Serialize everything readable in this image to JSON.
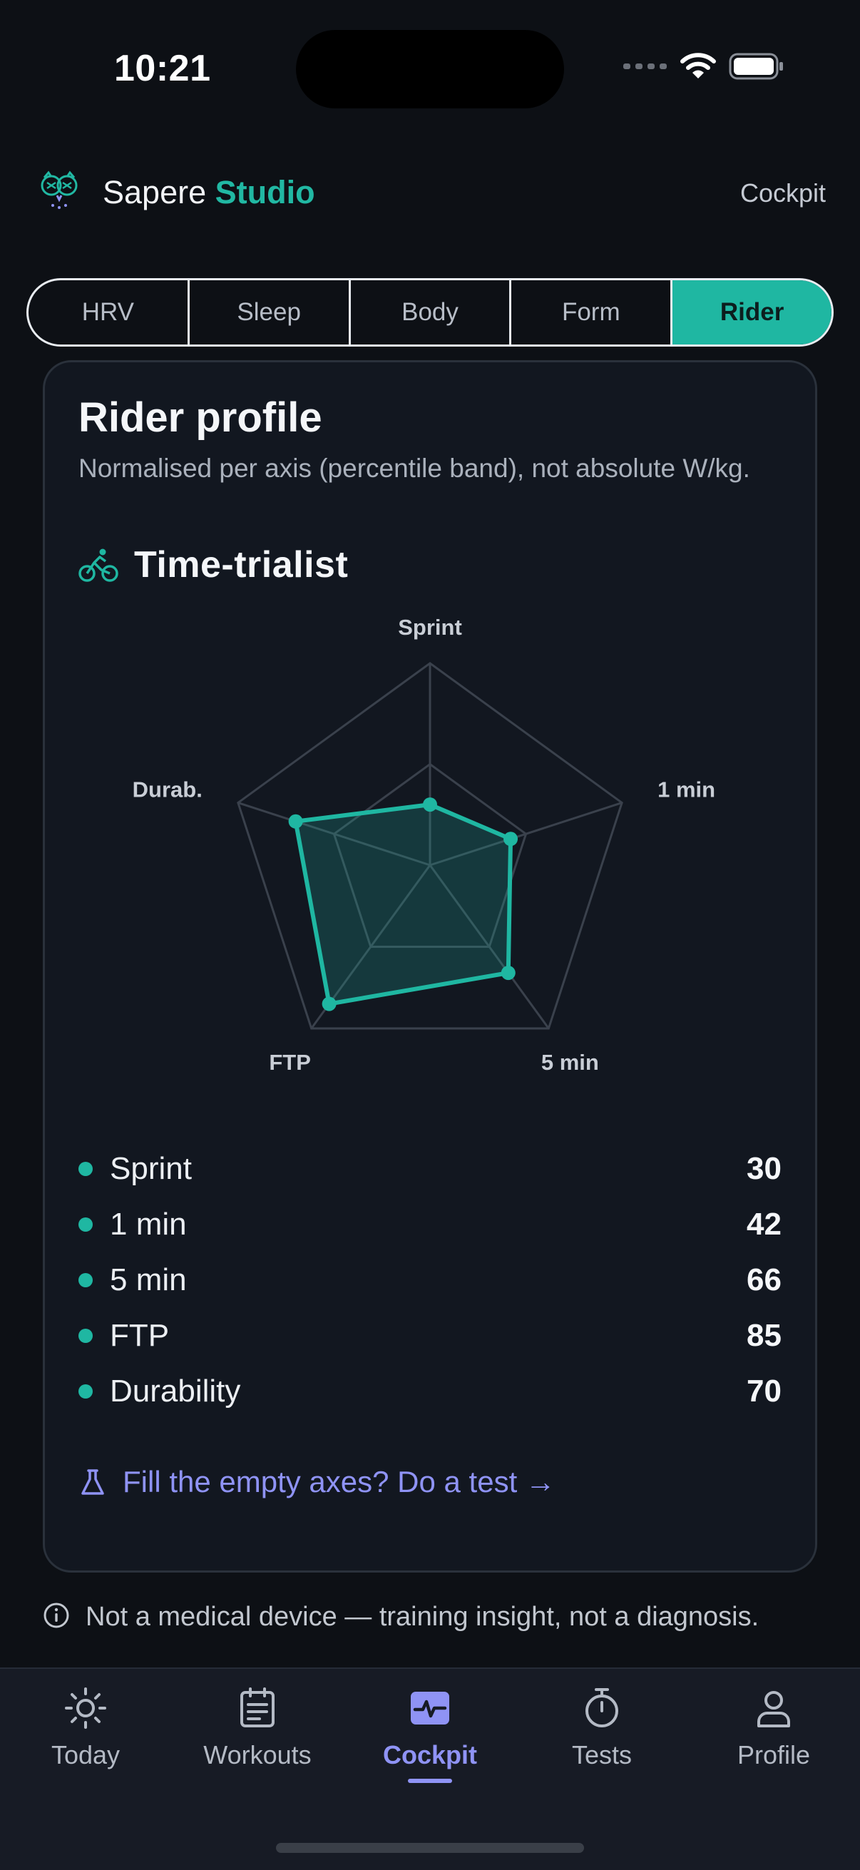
{
  "status": {
    "time": "10:21"
  },
  "header": {
    "brand_main": "Sapere",
    "brand_accent": "Studio",
    "link": "Cockpit"
  },
  "segments": [
    "HRV",
    "Sleep",
    "Body",
    "Form",
    "Rider"
  ],
  "active_segment": "Rider",
  "card": {
    "title": "Rider profile",
    "subtitle": "Normalised per axis (percentile band), not absolute W/kg.",
    "archetype": "Time-trialist"
  },
  "chart_data": {
    "type": "radar",
    "axes": [
      "Sprint",
      "1 min",
      "5 min",
      "FTP",
      "Durab."
    ],
    "values": [
      30,
      42,
      66,
      85,
      70
    ],
    "range": [
      0,
      100
    ],
    "grid_levels": [
      50,
      100
    ],
    "color": "#1fb7a2"
  },
  "metrics": [
    {
      "label": "Sprint",
      "value": "30"
    },
    {
      "label": "1 min",
      "value": "42"
    },
    {
      "label": "5 min",
      "value": "66"
    },
    {
      "label": "FTP",
      "value": "85"
    },
    {
      "label": "Durability",
      "value": "70"
    }
  ],
  "cta": {
    "label": "Fill the empty axes? Do a test →"
  },
  "disclaimer": "Not a medical device — training insight, not a diagnosis.",
  "tabbar": {
    "items": [
      {
        "label": "Today",
        "icon": "sun-icon"
      },
      {
        "label": "Workouts",
        "icon": "clipboard-icon"
      },
      {
        "label": "Cockpit",
        "icon": "pulse-icon"
      },
      {
        "label": "Tests",
        "icon": "stopwatch-icon"
      },
      {
        "label": "Profile",
        "icon": "person-icon"
      }
    ],
    "active": "Cockpit"
  },
  "colors": {
    "accent": "#1fb7a2",
    "link": "#8f93f5",
    "background": "#0d1015",
    "card": "#121720"
  }
}
